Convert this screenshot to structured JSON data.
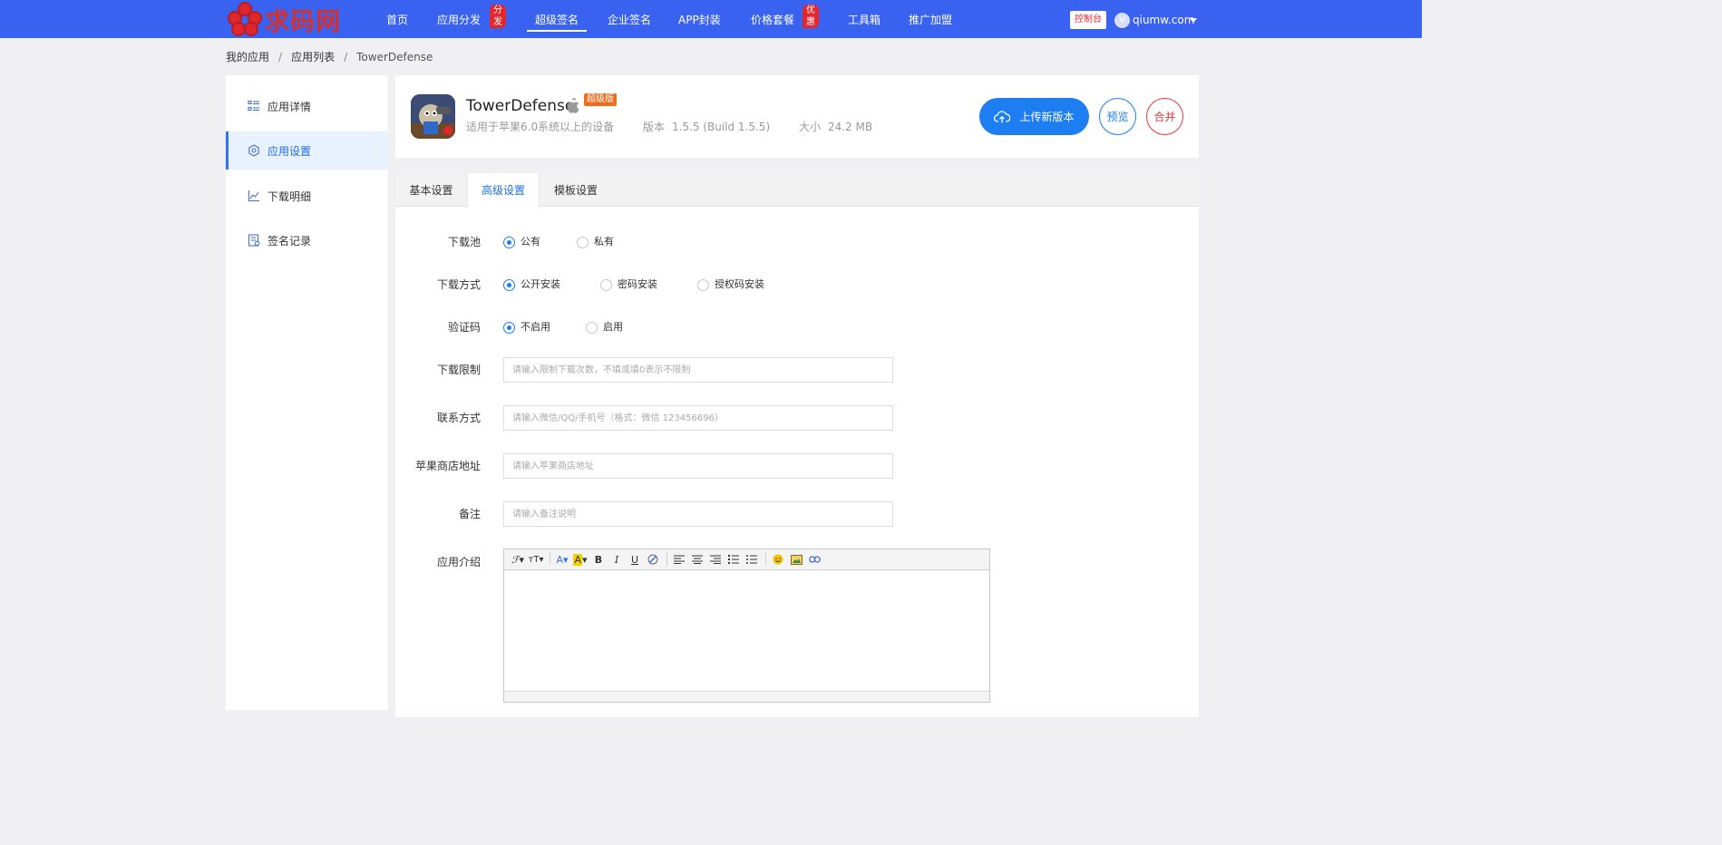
{
  "logo": {
    "text": "求码网"
  },
  "nav": {
    "items": [
      {
        "label": "首页"
      },
      {
        "label": "应用分发",
        "badge": "分发"
      },
      {
        "label": "超级签名",
        "active": true
      },
      {
        "label": "企业签名"
      },
      {
        "label": "APP封装"
      },
      {
        "label": "价格套餐",
        "badge": "优惠"
      },
      {
        "label": "工具箱"
      },
      {
        "label": "推广加盟"
      }
    ],
    "console_label": "控制台",
    "user": {
      "avatar": "V",
      "name": "qiumw.com"
    }
  },
  "breadcrumb": {
    "items": [
      "我的应用",
      "应用列表",
      "TowerDefense"
    ]
  },
  "sidebar": {
    "items": [
      {
        "label": "应用详情",
        "icon": "list-detail-icon"
      },
      {
        "label": "应用设置",
        "icon": "settings-gear-icon",
        "active": true
      },
      {
        "label": "下载明细",
        "icon": "chart-line-icon"
      },
      {
        "label": "签名记录",
        "icon": "record-doc-icon"
      }
    ]
  },
  "app": {
    "name": "TowerDefense",
    "badge": "超级版",
    "compat": "适用于苹果6.0系统以上的设备",
    "version_label": "版本",
    "version": "1.5.5 (Build 1.5.5)",
    "size_label": "大小",
    "size": "24.2 MB",
    "upload_label": "上传新版本",
    "preview_label": "预览",
    "merge_label": "合并"
  },
  "tabs": [
    {
      "label": "基本设置"
    },
    {
      "label": "高级设置",
      "active": true
    },
    {
      "label": "模板设置"
    }
  ],
  "form": {
    "pool": {
      "label": "下载池",
      "options": [
        "公有",
        "私有"
      ],
      "selected": "公有"
    },
    "method": {
      "label": "下载方式",
      "options": [
        "公开安装",
        "密码安装",
        "授权码安装"
      ],
      "selected": "公开安装"
    },
    "captcha": {
      "label": "验证码",
      "options": [
        "不启用",
        "启用"
      ],
      "selected": "不启用"
    },
    "limit": {
      "label": "下载限制",
      "value": "",
      "placeholder": "请输入限制下载次数，不填或填0表示不限制"
    },
    "contact": {
      "label": "联系方式",
      "value": "",
      "placeholder": "请输入微信/QQ/手机号（格式：微信 123456696）"
    },
    "appstore": {
      "label": "苹果商店地址",
      "value": "",
      "placeholder": "请输入苹果商店地址"
    },
    "note": {
      "label": "备注",
      "value": "",
      "placeholder": "请输入备注说明"
    },
    "intro": {
      "label": "应用介绍"
    }
  },
  "colors": {
    "nav_bg": "#3a62f0",
    "accent": "#1c7ef0",
    "danger": "#e4393c",
    "badge_orange": "#f26b1d"
  }
}
